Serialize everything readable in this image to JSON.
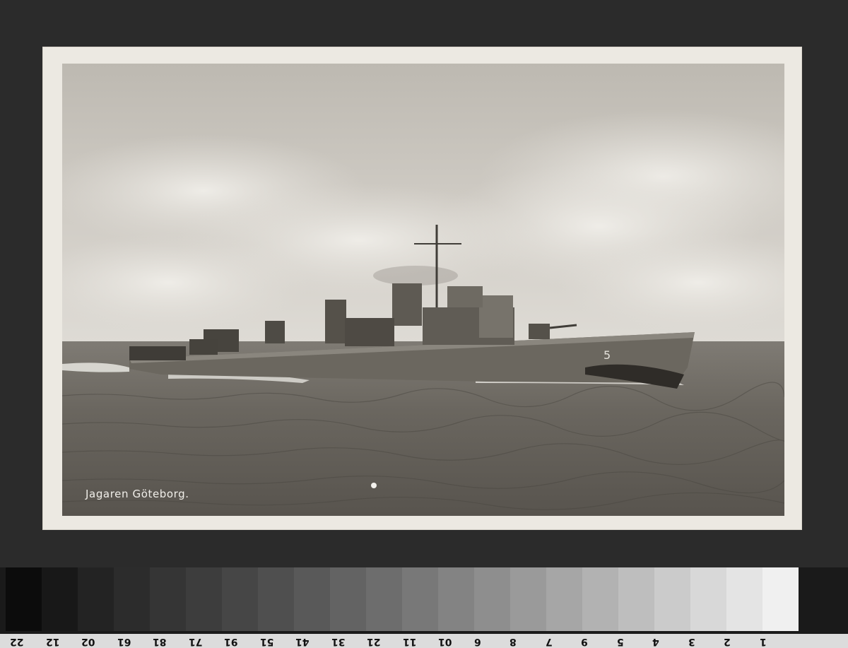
{
  "photo": {
    "caption": "Jagaren Göteborg.",
    "hull_number": "5"
  },
  "gray_scale": {
    "patches": [
      "#0c0c0c",
      "#181818",
      "#232323",
      "#2c2c2c",
      "#353535",
      "#3d3d3d",
      "#464646",
      "#4f4f4f",
      "#595959",
      "#636363",
      "#6d6d6d",
      "#787878",
      "#838383",
      "#8e8e8e",
      "#9a9a9a",
      "#a6a6a6",
      "#b2b2b2",
      "#bebebe",
      "#cbcbcb",
      "#d8d8d8",
      "#e4e4e4",
      "#f0f0f0"
    ],
    "numbers": [
      "22",
      "12",
      "02",
      "61",
      "81",
      "71",
      "91",
      "51",
      "41",
      "31",
      "21",
      "11",
      "01",
      "6",
      "8",
      "7",
      "9",
      "5",
      "4",
      "3",
      "2",
      "1"
    ]
  }
}
